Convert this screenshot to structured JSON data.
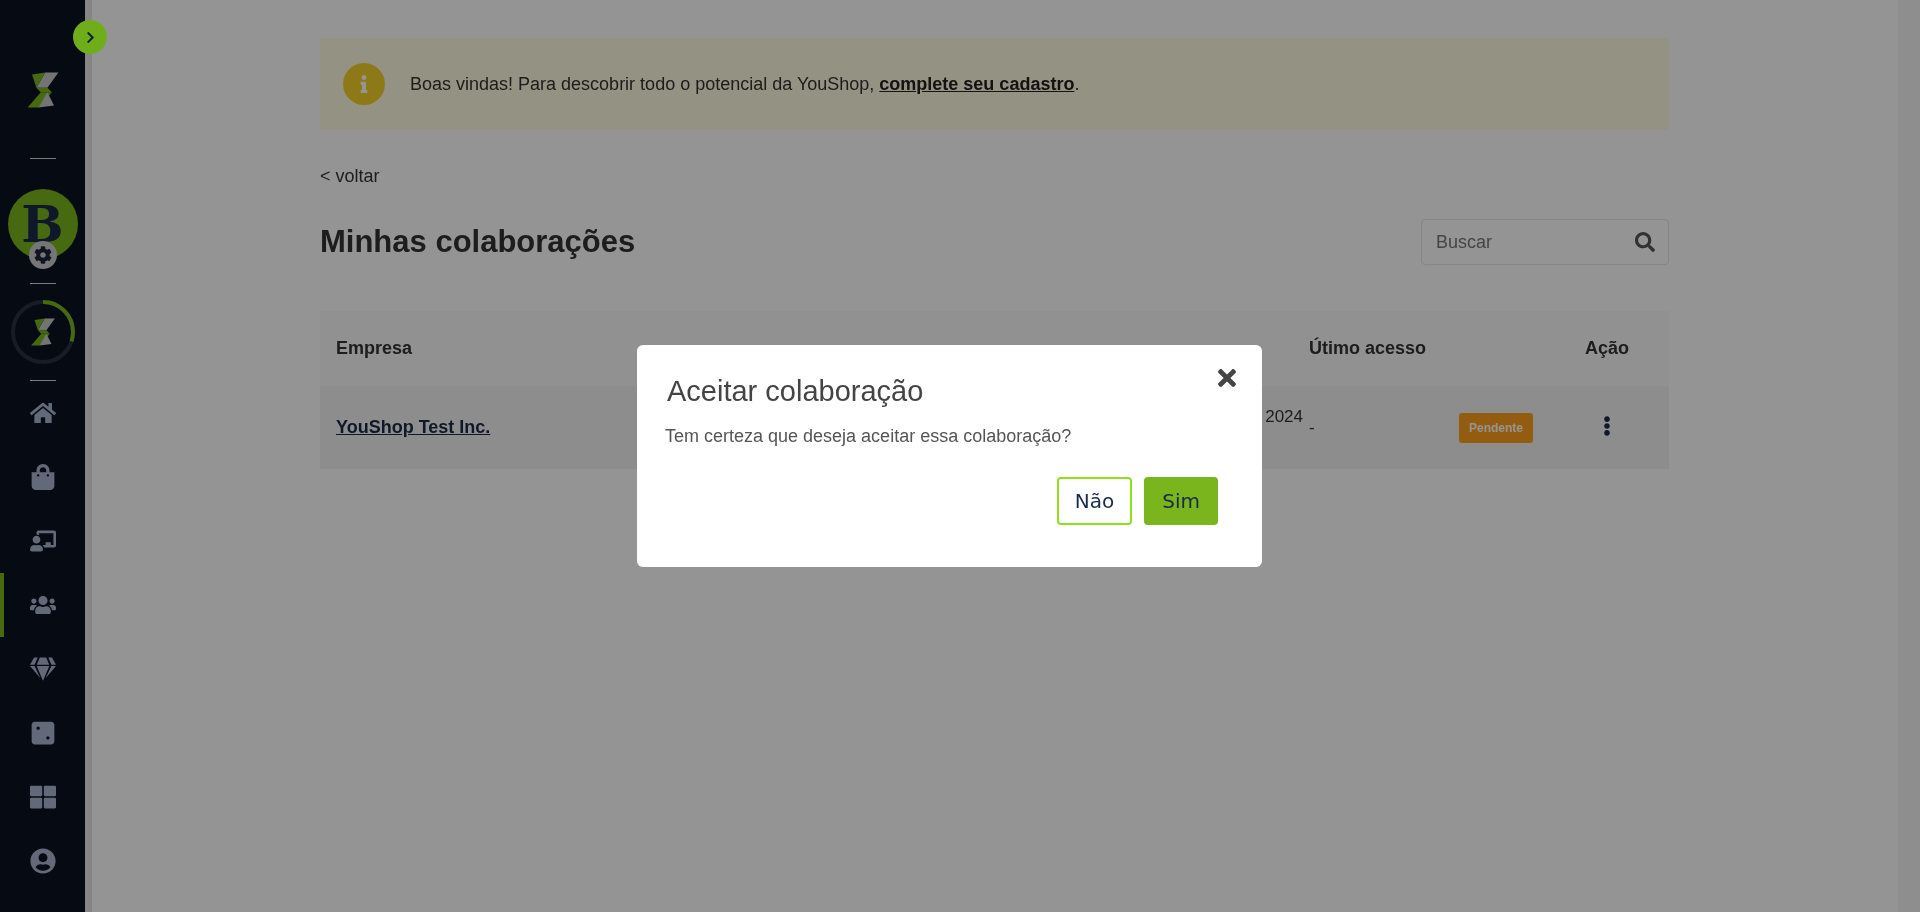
{
  "sidebar": {
    "avatar_letter": "B",
    "progress": {
      "level": 0.3
    },
    "items": [
      {
        "kind": "home",
        "selected": false
      },
      {
        "kind": "bag",
        "selected": false
      },
      {
        "kind": "presentation",
        "selected": false
      },
      {
        "kind": "team",
        "selected": true
      },
      {
        "kind": "diamond",
        "selected": false
      },
      {
        "kind": "dice",
        "selected": false
      },
      {
        "kind": "apps",
        "selected": false
      },
      {
        "kind": "user",
        "selected": false
      }
    ]
  },
  "banner": {
    "text": "Boas vindas! Para descobrir todo o potencial da YouShop, ",
    "link": "complete seu cadastro",
    "end": "."
  },
  "back_link": "< voltar",
  "page_title": "Minhas colaborações",
  "search": {
    "placeholder": "Buscar"
  },
  "table": {
    "columns": [
      "Empresa",
      "Útimo acesso",
      "Ação"
    ],
    "rows": [
      {
        "company": "YouShop Test Inc.",
        "cadastro": "2024",
        "last_access": "-",
        "status": "Pendente"
      }
    ]
  },
  "modal": {
    "title": "Aceitar colaboração",
    "message": "Tem certeza que deseja aceitar essa colaboração?",
    "buttons": [
      {
        "label": "Não",
        "kind": "secondary"
      },
      {
        "label": "Sim",
        "kind": "primary"
      }
    ]
  }
}
